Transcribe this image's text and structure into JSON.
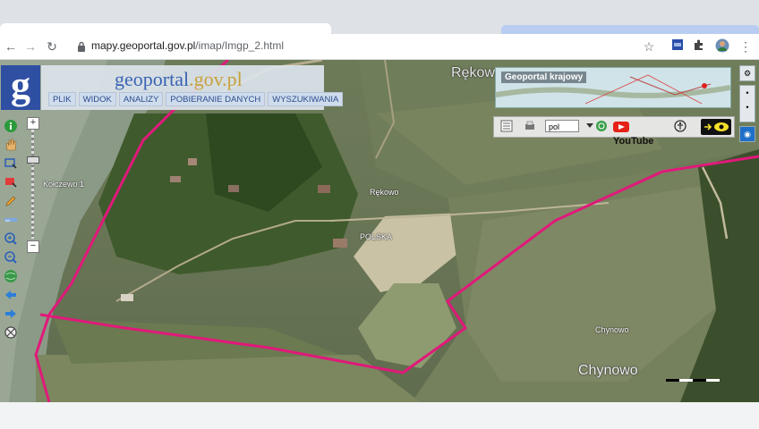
{
  "browser": {
    "url_host": "mapy.geoportal.gov.pl",
    "url_path": "/imap/Imgp_2.html"
  },
  "app": {
    "brand_main": "geoportal",
    "brand_suffix": ".gov.pl",
    "logo_letter": "g",
    "menu": [
      "PLIK",
      "WIDOK",
      "ANALIZY",
      "POBIERANIE DANYCH",
      "WYSZUKIWANIA"
    ]
  },
  "overview": {
    "title": "Geoportal krajowy"
  },
  "toolbar": {
    "language": "pol",
    "youtube": "YouTube"
  },
  "labels": {
    "rekow_top": "Rękow",
    "kolczewo": "Kołczewo 1",
    "rekowo": "Rękowo",
    "polska": "POLSKA",
    "chynowo_small": "Chynowo",
    "chynowo_big": "Chynowo"
  },
  "colors": {
    "boundary": "#e0197a",
    "logo_bg": "#2f4fa3",
    "brand_blue": "#3a63b5"
  }
}
